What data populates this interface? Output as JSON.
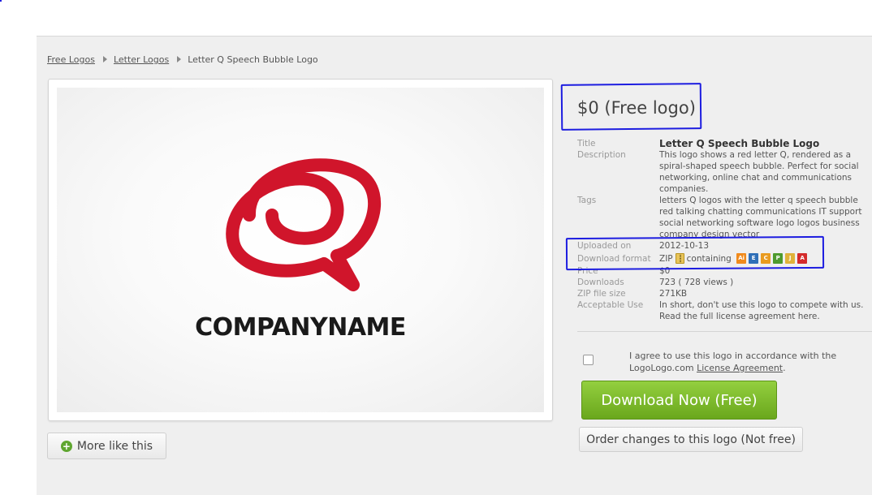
{
  "breadcrumb": {
    "items": [
      "Free Logos",
      "Letter Logos"
    ],
    "current": "Letter Q Speech Bubble Logo"
  },
  "preview": {
    "company_name": "COMPANYNAME",
    "logo_color": "#d0152b"
  },
  "more_like_this": "More like this",
  "price_heading": "$0 (Free logo)",
  "details": {
    "title_label": "Title",
    "title_value": "Letter Q Speech Bubble Logo",
    "description_label": "Description",
    "description_value": "This logo shows a red letter Q, rendered as a spiral-shaped speech bubble. Perfect for social networking, online chat and communications companies.",
    "tags_label": "Tags",
    "tags_value": "letters Q logos with the letter q speech bubble red talking chatting communications IT support social networking software logo logos business company design vector",
    "uploaded_label": "Uploaded on",
    "uploaded_value": "2012-10-13",
    "format_label": "Download format",
    "format_zip": "ZIP",
    "format_containing": "containing",
    "format_icons": [
      "ai-icon",
      "eps-icon",
      "cdr-icon",
      "png-icon",
      "jpg-icon",
      "pdf-icon"
    ],
    "price_label": "Price",
    "price_value": "$0",
    "downloads_label": "Downloads",
    "downloads_value": "723  ( 728 views )",
    "zipsize_label": "ZIP file size",
    "zipsize_value": "271KB",
    "use_label": "Acceptable Use",
    "use_value": "In short, don't use this logo to compete with us. Read the full license agreement here."
  },
  "agreement": {
    "text": "I agree to use this logo in accordance with the LogoLogo.com",
    "link": "License Agreement",
    "end": "."
  },
  "download_button": "Download Now (Free)",
  "order_button": "Order changes to this logo (Not free)",
  "colors": {
    "annotation": "#1d1de0",
    "download_green": "#7ab92a"
  }
}
